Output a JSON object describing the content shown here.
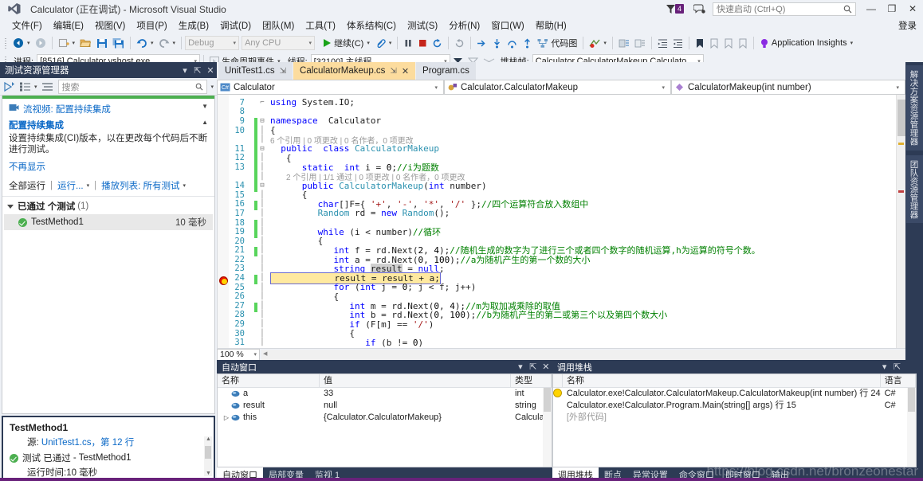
{
  "titlebar": {
    "title": "Calculator (正在调试) - Microsoft Visual Studio",
    "logo_icon": "visual-studio-logo",
    "notification_count": "4",
    "flag_icon": "notification-flag-icon",
    "feedback_icon": "send-feedback-icon",
    "quick_launch_placeholder": "快速启动 (Ctrl+Q)",
    "quick_launch_value": "",
    "search_icon": "magnifier-icon",
    "minimize": "—",
    "restore": "❐",
    "close": "✕",
    "signin": "登录"
  },
  "menubar": {
    "items": [
      "文件(F)",
      "编辑(E)",
      "视图(V)",
      "项目(P)",
      "生成(B)",
      "调试(D)",
      "团队(M)",
      "工具(T)",
      "体系结构(C)",
      "测试(S)",
      "分析(N)",
      "窗口(W)",
      "帮助(H)"
    ]
  },
  "toolbar1": {
    "nav_back_icon": "navigate-backward-icon",
    "nav_forward_icon": "navigate-forward-icon",
    "new_project_icon": "new-project-icon",
    "open_file_icon": "open-file-icon",
    "save_icon": "save-icon",
    "save_all_icon": "save-all-icon",
    "undo_icon": "undo-icon",
    "redo_icon": "redo-icon",
    "config_value": "Debug",
    "platform_value": "Any CPU",
    "continue_label": "继续(C)",
    "continue_icon": "play-icon",
    "attach_icon": "attach-to-process-icon",
    "pause_icon": "pause-icon",
    "stop_icon": "stop-icon",
    "restart_icon": "restart-icon",
    "refresh_icon": "refresh-icon",
    "stepover_icon": "step-over-icon",
    "stepinto_icon": "step-into-icon",
    "stepout_icon": "step-out-icon",
    "stepnext_icon": "step-next-icon",
    "codemap_icon": "code-map-icon",
    "codemap_label": "代码图",
    "intellitrace_icon": "intellitrace-icon",
    "comment_icon": "comment-selection-icon",
    "uncomment_icon": "uncomment-selection-icon",
    "indent_icon": "increase-indent-icon",
    "outdent_icon": "decrease-indent-icon",
    "bookmark_icon": "bookmark-icon",
    "bookmark_prev_icon": "previous-bookmark-icon",
    "bookmark_next_icon": "next-bookmark-icon",
    "bookmark_clear_icon": "clear-bookmarks-icon",
    "app_insights_icon": "application-insights-icon",
    "app_insights_label": "Application Insights"
  },
  "toolbar2": {
    "process_label": "进程:",
    "process_value": "[8516] Calculator.vshost.exe",
    "lifecycle_icon": "lifecycle-events-icon",
    "lifecycle_label": "生命周期事件",
    "thread_label": "线程:",
    "thread_value": "[32100] 主线程",
    "filter_icon": "filter-icon",
    "flag_icon": "flag-icon",
    "crosshatch_icon": "no-filter-icon",
    "stackframe_label": "堆栈帧:",
    "stackframe_value": "Calculator.CalculatorMakeup.Calculato"
  },
  "test_explorer": {
    "title": "测试资源管理器",
    "run_tests_icon": "run-tests-icon",
    "group_by_icon": "group-by-icon",
    "list_icon": "list-view-icon",
    "search_placeholder": "搜索",
    "search_icon": "magnifier-icon",
    "ci_video_icon": "video-icon",
    "ci_video_label": "流视频: 配置持续集成",
    "ci_heading": "配置持续集成",
    "ci_desc": "设置持续集成(CI)版本，以在更改每个代码后不断进行测试。",
    "ci_dismiss": "不再显示",
    "run_all": "全部运行",
    "run_menu": "运行...",
    "playlist": "播放列表: 所有测试",
    "group_label": "已通过 个测试",
    "group_count": "(1)",
    "tests": [
      {
        "name": "TestMethod1",
        "duration": "10 毫秒",
        "status_icon": "test-passed-icon"
      }
    ],
    "detail": {
      "title": "TestMethod1",
      "source_label": "源:",
      "source_link": "UnitTest1.cs，第 12 行",
      "result_prefix": "测试",
      "result_status": "已通过",
      "result_suffix": "- TestMethod1",
      "elapsed": "运行时间:10 毫秒",
      "status_icon": "test-passed-icon"
    }
  },
  "editor": {
    "tabs": [
      {
        "label": "UnitTest1.cs",
        "active": false,
        "pin_icon": "pin-icon"
      },
      {
        "label": "CalculatorMakeup.cs",
        "active": true,
        "pin_icon": "pin-icon",
        "close_icon": "close-icon"
      },
      {
        "label": "Program.cs",
        "active": false
      }
    ],
    "nav_project": "Calculator",
    "nav_project_icon": "csharp-project-icon",
    "nav_type": "Calculator.CalculatorMakeup",
    "nav_type_icon": "class-icon",
    "nav_member": "CalculatorMakeup(int number)",
    "nav_member_icon": "method-icon",
    "zoom_level": "100 %",
    "lines": [
      {
        "n": "7",
        "change": false,
        "outline": "",
        "segments": [
          {
            "t": "    using System.IO;",
            "c": "plain",
            "kw": "using"
          }
        ]
      },
      {
        "n": "8",
        "change": false,
        "outline": "",
        "segments": []
      },
      {
        "n": "9",
        "change": true,
        "outline": "-",
        "segments": []
      },
      {
        "n": "10",
        "change": false,
        "outline": "",
        "segments": []
      },
      {
        "n": "",
        "change": true,
        "outline": "",
        "segments": []
      },
      {
        "n": "11",
        "change": true,
        "outline": "-",
        "segments": []
      },
      {
        "n": "12",
        "change": true,
        "outline": "",
        "segments": []
      },
      {
        "n": "13",
        "change": true,
        "outline": "",
        "segments": []
      },
      {
        "n": "",
        "change": true,
        "outline": "",
        "segments": []
      },
      {
        "n": "14",
        "change": true,
        "outline": "-",
        "segments": []
      },
      {
        "n": "15",
        "change": false,
        "outline": "",
        "segments": []
      },
      {
        "n": "16",
        "change": true,
        "outline": "",
        "segments": []
      },
      {
        "n": "17",
        "change": false,
        "outline": "",
        "segments": []
      },
      {
        "n": "18",
        "change": true,
        "outline": "",
        "segments": []
      },
      {
        "n": "19",
        "change": true,
        "outline": "",
        "segments": []
      },
      {
        "n": "20",
        "change": false,
        "outline": "",
        "segments": []
      },
      {
        "n": "21",
        "change": true,
        "outline": "",
        "segments": []
      },
      {
        "n": "22",
        "change": false,
        "outline": "",
        "segments": []
      },
      {
        "n": "23",
        "change": false,
        "outline": "",
        "segments": []
      },
      {
        "n": "24",
        "change": false,
        "outline": "",
        "segments": []
      },
      {
        "n": "25",
        "change": true,
        "outline": "",
        "segments": []
      },
      {
        "n": "26",
        "change": false,
        "outline": "",
        "segments": []
      },
      {
        "n": "27",
        "change": false,
        "outline": "",
        "segments": []
      },
      {
        "n": "28",
        "change": false,
        "outline": "",
        "segments": []
      },
      {
        "n": "29",
        "change": true,
        "outline": "",
        "segments": []
      },
      {
        "n": "30",
        "change": false,
        "outline": "",
        "segments": []
      },
      {
        "n": "31",
        "change": false,
        "outline": "",
        "segments": []
      }
    ],
    "code_text": {
      "l7": "using System.IO;",
      "l9": "namespace  Calculator",
      "l10": "{",
      "lens1": "6 个引用 | 0 项更改 | 0 名作者，0 项更改",
      "l11": "public  class CalculatorMakeup",
      "l12": "{",
      "l13_a": "static  int i = 0;",
      "l13_c": "//i为题数",
      "lens2": "2 个引用 | 1/1 通过 | 0 项更改 | 0 名作者，0 项更改",
      "l14": "public CalculatorMakeup(int number)",
      "l15": "{",
      "l16_a": "char[]F={ '+', '-', '*', '/' };",
      "l16_c": "//四个运算符合放入数组中",
      "l17": "Random rd = new Random();",
      "l19_a": "while (i < number)",
      "l19_c": "//循环",
      "l20": "{",
      "l21_a": "int f = rd.Next(2, 4);",
      "l21_c": "//随机生成的数字为了进行三个或者四个数字的随机运算,h为运算的符号个数。",
      "l22_a": "int a = rd.Next(0, 100);",
      "l22_c": "//a为随机产生的第一个数的大小",
      "l23": "string result = null;",
      "l24": "result = result + a;",
      "l25": "for (int j = 0; j < f; j++)",
      "l26": "{",
      "l27_a": "int m = rd.Next(0, 4);",
      "l27_c": "//m为取加减乘除的取值",
      "l28_a": "int b = rd.Next(0, 100);",
      "l28_c": "//b为随机产生的第二或第三个以及第四个数大小",
      "l29": "if (F[m] == '/')",
      "l30": "{",
      "l31": "if (b != 0)"
    }
  },
  "autos": {
    "title": "自动窗口",
    "columns": [
      "名称",
      "值",
      "类型"
    ],
    "rows": [
      {
        "name": "a",
        "value": "33",
        "type": "int",
        "expandable": false,
        "icon": "variable-icon"
      },
      {
        "name": "result",
        "value": "null",
        "type": "string",
        "expandable": false,
        "icon": "variable-icon"
      },
      {
        "name": "this",
        "value": "{Calculator.CalculatorMakeup}",
        "type": "Calculato",
        "expandable": true,
        "icon": "variable-icon"
      }
    ]
  },
  "callstack": {
    "title": "调用堆栈",
    "columns": [
      "名称",
      "语言"
    ],
    "rows": [
      {
        "name": "Calculator.exe!Calculator.CalculatorMakeup.CalculatorMakeup(int number) 行 24",
        "lang": "C#",
        "current": true
      },
      {
        "name": "Calculator.exe!Calculator.Program.Main(string[] args) 行 15",
        "lang": "C#",
        "current": false
      },
      {
        "name": "[外部代码]",
        "lang": "",
        "current": false,
        "external": true
      }
    ]
  },
  "bottom_tabs_left": [
    {
      "label": "自动窗口",
      "active": true
    },
    {
      "label": "局部变量",
      "active": false
    },
    {
      "label": "监视 1",
      "active": false
    }
  ],
  "bottom_tabs_right": [
    {
      "label": "调用堆栈",
      "active": true
    },
    {
      "label": "断点",
      "active": false
    },
    {
      "label": "异常设置",
      "active": false
    },
    {
      "label": "命令窗口",
      "active": false
    },
    {
      "label": "即时窗口",
      "active": false
    },
    {
      "label": "输出",
      "active": false
    }
  ],
  "right_rail": [
    {
      "label": "解决方案资源管理器"
    },
    {
      "label": "团队资源管理器"
    }
  ],
  "watermark": "https://blog.csdn.net/bronzeonestar",
  "colors": {
    "accent_purple": "#68217a",
    "chrome_bg": "#eef1f6",
    "pane_header": "#2d3b55",
    "active_tab": "#fcdc9e",
    "pass_green": "#4caf50",
    "breakpoint_red": "#e51400",
    "current_stmt_yellow": "#ffd400",
    "link_blue": "#0b69c7",
    "keyword_blue": "#0000ff",
    "type_teal": "#2b91af",
    "comment_green": "#008000",
    "string_red": "#a31515"
  }
}
